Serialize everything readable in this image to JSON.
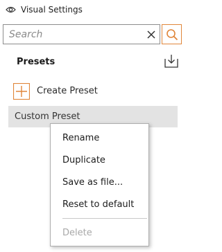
{
  "window": {
    "title": "Visual Settings",
    "icon": "eye-icon"
  },
  "search": {
    "placeholder": "Search",
    "value": "",
    "clear_icon": "close-icon",
    "search_icon": "search-icon"
  },
  "presets": {
    "title": "Presets",
    "export_icon": "download-icon",
    "create_label": "Create Preset",
    "create_icon": "plus-icon",
    "items": [
      {
        "label": "Custom Preset",
        "selected": true
      }
    ]
  },
  "context_menu": {
    "items": [
      {
        "label": "Rename",
        "enabled": true
      },
      {
        "label": "Duplicate",
        "enabled": true
      },
      {
        "label": "Save as file...",
        "enabled": true
      },
      {
        "label": "Reset to default",
        "enabled": true
      },
      {
        "label": "Delete",
        "enabled": false
      }
    ]
  },
  "colors": {
    "accent": "#e0863a",
    "selected_row": "#e3e3e3",
    "disabled_text": "#a8a8a8"
  }
}
